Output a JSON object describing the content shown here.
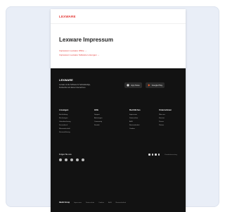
{
  "brand": {
    "name": "LEXWARE",
    "color": "#e3322f"
  },
  "page": {
    "title": "Lexware Impressum",
    "links": [
      "Impressum Lexware Office →",
      "Impressum Lexware Software Lösungen →"
    ]
  },
  "footer": {
    "brand": "LEXWARE",
    "description": "Lexware ist die Software für Selbstständige, Freiberufler und kleine Unternehmen.",
    "app_store": "App Store",
    "google_play": "Google Play",
    "columns": [
      {
        "title": "Lösungen",
        "links": [
          "Buchhaltung",
          "Rechnungen",
          "Lohnabrechnung",
          "Kassenbuch",
          "Warenwirtschaft",
          "Steuererklärung"
        ]
      },
      {
        "title": "Hilfe",
        "links": [
          "Support",
          "Anleitungen",
          "Community",
          "Kontakt"
        ]
      },
      {
        "title": "Rechtliches",
        "links": [
          "Impressum",
          "Datenschutz",
          "AGB",
          "Barrierefreiheit",
          "Cookies"
        ]
      },
      {
        "title": "Unternehmen",
        "links": [
          "Über uns",
          "Karriere",
          "Presse",
          "Partner"
        ]
      }
    ],
    "social_heading": "Folgen Sie uns",
    "rating_label": "Kundenbewertung",
    "bottom": [
      "Haufe Group",
      "Impressum",
      "Datenschutz",
      "Cookies",
      "AGB",
      "Barrierefreiheit"
    ]
  },
  "colors": {
    "footer_bg": "#121212",
    "card_bg": "#e9eef7",
    "accent": "#e3322f"
  },
  "icons": [
    "apple-icon",
    "play-icon",
    "social-icon"
  ]
}
